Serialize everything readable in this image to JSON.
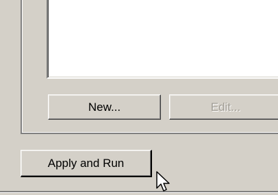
{
  "buttons": {
    "new_label": "New...",
    "edit_label": "Edit...",
    "apply_label": "Apply and Run"
  },
  "state": {
    "edit_enabled": false
  },
  "icons": {
    "cursor": "arrow-cursor-icon"
  },
  "colors": {
    "face": "#d4d0c8",
    "shadow": "#808080",
    "highlight": "#ffffff",
    "disabled_text": "#a09c94"
  }
}
